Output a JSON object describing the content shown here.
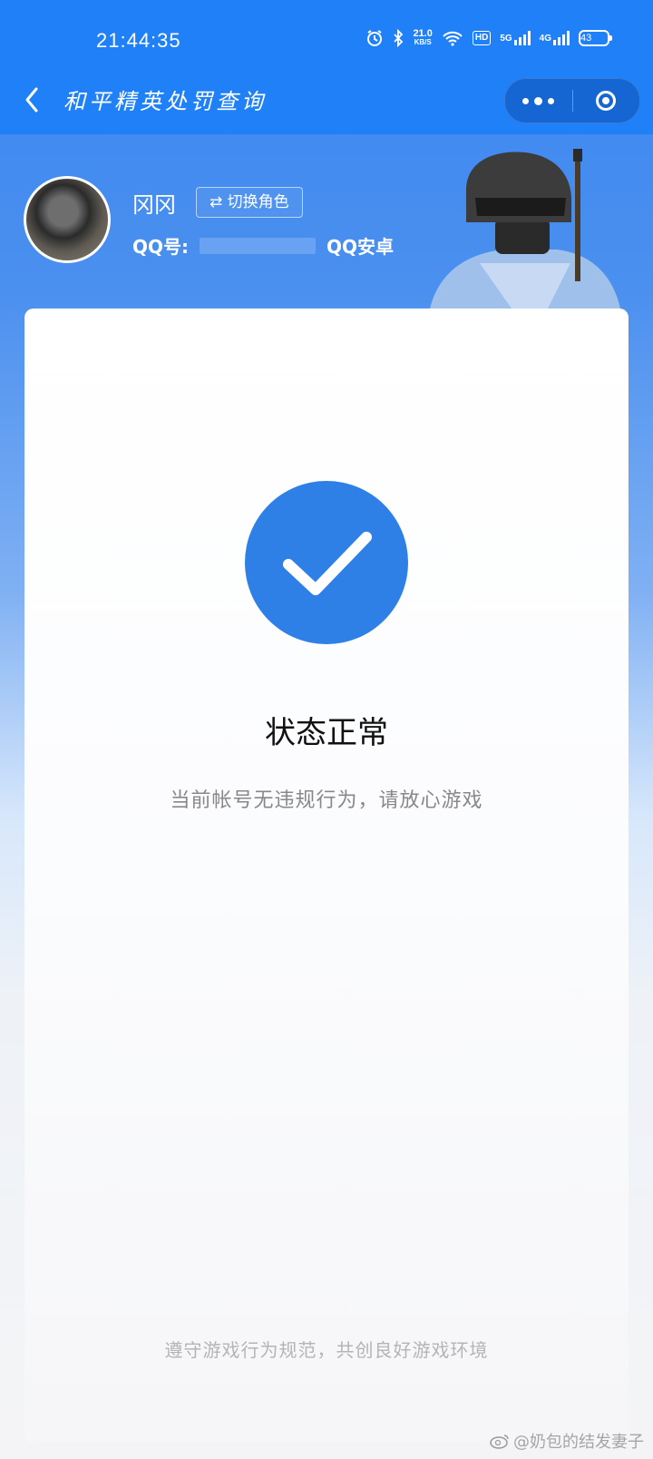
{
  "status_bar": {
    "time": "21:44:35",
    "net_speed_value": "21.0",
    "net_speed_unit": "KB/S",
    "hd_label": "HD",
    "signal_1_label": "5G",
    "signal_2_label": "4G",
    "battery_level": "43"
  },
  "navbar": {
    "title": "和平精英处罚查询"
  },
  "profile": {
    "nickname": "冈冈",
    "switch_label": "⇄ 切换角色",
    "qq_prefix": "QQ号:",
    "platform": "QQ安卓"
  },
  "result": {
    "title": "状态正常",
    "description": "当前帐号无违规行为，请放心游戏"
  },
  "footer": {
    "note": "遵守游戏行为规范，共创良好游戏环境"
  },
  "watermark": {
    "text": "@奶包的结发妻子"
  },
  "colors": {
    "primary_blue": "#1f80f7",
    "check_blue": "#2e7fe6"
  }
}
